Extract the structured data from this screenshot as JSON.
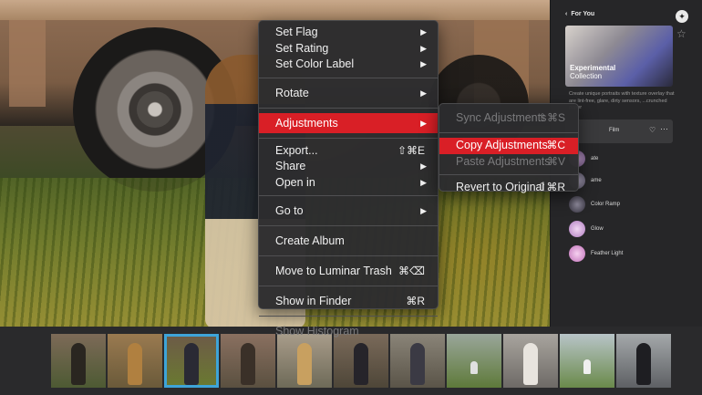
{
  "context_menu": {
    "items": [
      {
        "label": "Set Flag",
        "submenu": true
      },
      {
        "label": "Set Rating",
        "submenu": true
      },
      {
        "label": "Set Color Label",
        "submenu": true
      },
      {
        "label": "Rotate",
        "submenu": true
      },
      {
        "label": "Adjustments",
        "submenu": true,
        "highlighted": true
      },
      {
        "label": "Export...",
        "shortcut": "⇧⌘E"
      },
      {
        "label": "Share",
        "submenu": true
      },
      {
        "label": "Open in",
        "submenu": true
      },
      {
        "label": "Go to",
        "submenu": true
      },
      {
        "label": "Create Album"
      },
      {
        "label": "Move to Luminar Trash",
        "shortcut": "⌘⌫"
      },
      {
        "label": "Show in Finder",
        "shortcut": "⌘R"
      },
      {
        "label": "Show Histogram",
        "disabled": true
      }
    ]
  },
  "adjustments_submenu": {
    "items": [
      {
        "label": "Sync Adjustments",
        "shortcut": "⇧⌘S",
        "disabled": true
      },
      {
        "label": "Copy Adjustments",
        "shortcut": "⌘C",
        "highlighted": true
      },
      {
        "label": "Paste Adjustments",
        "shortcut": "⌘V",
        "disabled": true
      },
      {
        "label": "Revert to Original",
        "shortcut": "⇧⌘R"
      }
    ]
  },
  "panel": {
    "back_label": "For You",
    "hero_title": "Experimental",
    "hero_subtitle": "Collection",
    "description": "Create unique portraits with texture overlay that are lint-free, glare, dirty sensors, ...crunched paper",
    "selected_look": "Film",
    "looks": [
      {
        "label": "ate"
      },
      {
        "label": "ame"
      },
      {
        "label": "Color Ramp"
      },
      {
        "label": "Glow"
      },
      {
        "label": "Feather Light"
      }
    ]
  },
  "colors": {
    "highlight": "#d91f26",
    "selection_outline": "#3ea4d8"
  },
  "filmstrip": {
    "count": 11,
    "selected_index": 2
  }
}
